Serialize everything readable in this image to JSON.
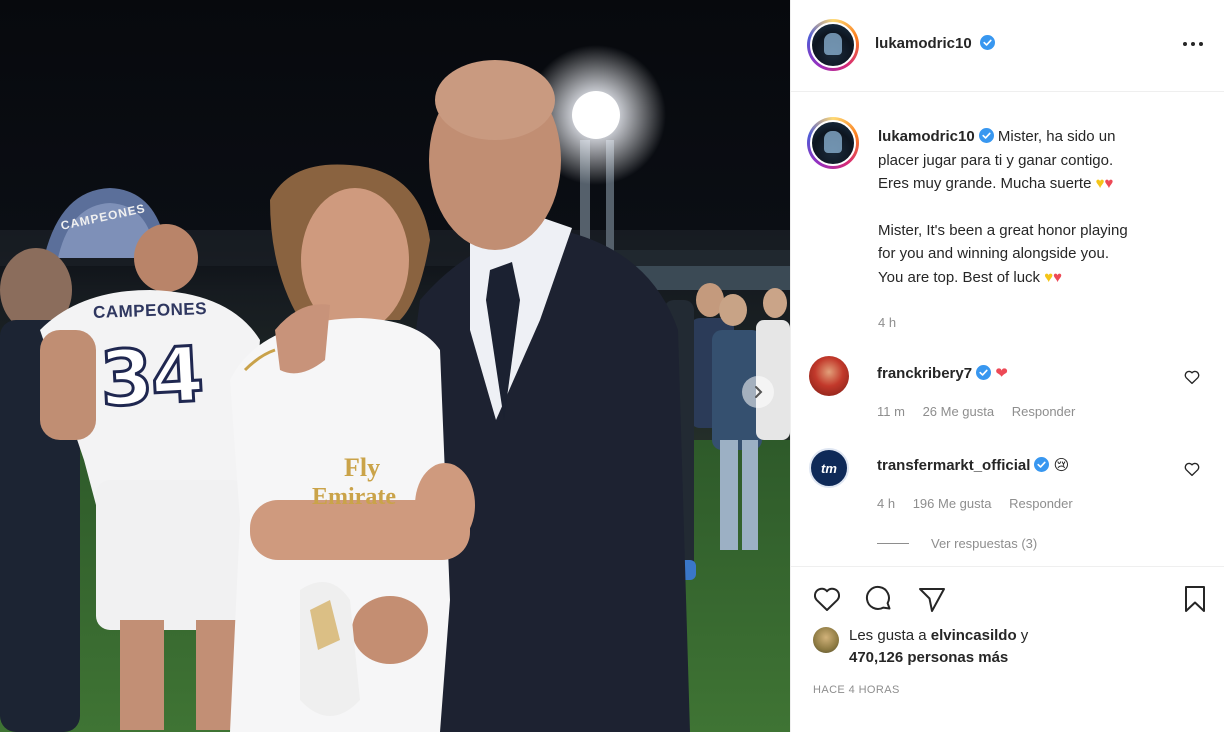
{
  "post": {
    "author": "lukamodric10",
    "verified": true,
    "caption_es_1": "Mister, ha sido un",
    "caption_es_2": "placer jugar para ti y ganar contigo.",
    "caption_es_3": "Eres muy grande. Mucha suerte",
    "caption_en_1": "Mister, It's been a great honor playing",
    "caption_en_2": "for you and winning alongside you.",
    "caption_en_3": "You are top. Best of luck",
    "caption_time": "4 h",
    "likes_prefix": "Les gusta a",
    "likes_user": "elvincasildo",
    "likes_connector": "y",
    "likes_count_text": "470,126 personas más",
    "posted_ago": "HACE 4 HORAS"
  },
  "photo": {
    "jersey_name": "CAMPEONES",
    "jersey_number": "34",
    "shirt_sponsor_line1": "Fly",
    "shirt_sponsor_line2": "Emirate",
    "sign_text": "CAMPEONES"
  },
  "comments": [
    {
      "user": "franckribery7",
      "verified": true,
      "text_emoji": "❤",
      "time": "11 m",
      "likes": "26 Me gusta",
      "reply_label": "Responder"
    },
    {
      "user": "transfermarkt_official",
      "verified": true,
      "text_emoji": "😢",
      "time": "4 h",
      "likes": "196 Me gusta",
      "reply_label": "Responder",
      "view_replies": "Ver respuestas (3)",
      "avatar_text": "tm"
    }
  ],
  "colors": {
    "verified_blue": "#3897f0",
    "heart_red": "#ed4956",
    "text": "#262626",
    "meta_gray": "#8e8e8e",
    "divider": "#efefef"
  },
  "icons": {
    "like": "heart-outline-icon",
    "comment": "speech-bubble-icon",
    "share": "paper-plane-icon",
    "save": "bookmark-icon",
    "more": "ellipsis-icon",
    "carousel_next": "chevron-right-icon"
  }
}
